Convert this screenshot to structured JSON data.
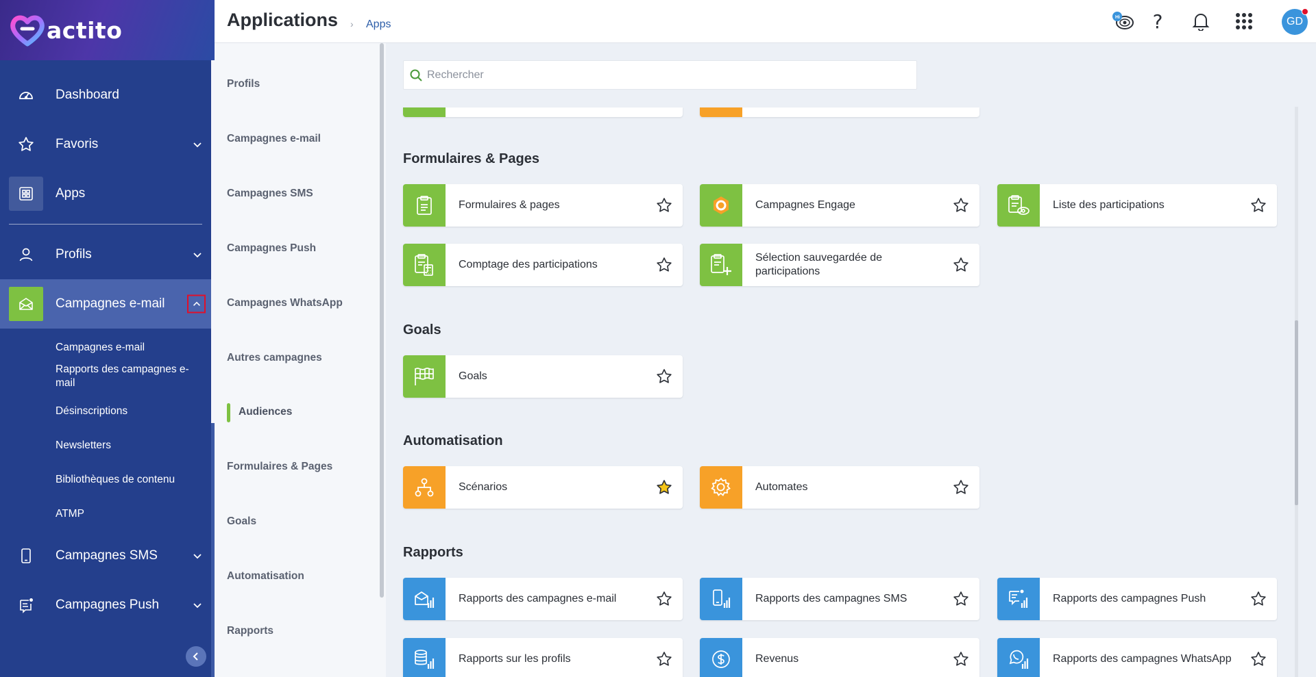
{
  "logo": {
    "text": "actito"
  },
  "sidebar": {
    "items": [
      {
        "id": "dashboard",
        "label": "Dashboard",
        "icon": "gauge-icon"
      },
      {
        "id": "favoris",
        "label": "Favoris",
        "icon": "star-icon"
      },
      {
        "id": "apps",
        "label": "Apps",
        "icon": "apps-grid-icon"
      },
      {
        "id": "profils",
        "label": "Profils",
        "icon": "user-icon"
      },
      {
        "id": "campagnes-email",
        "label": "Campagnes e-mail",
        "icon": "envelope-open-icon"
      },
      {
        "id": "campagnes-sms",
        "label": "Campagnes SMS",
        "icon": "phone-icon"
      },
      {
        "id": "campagnes-push",
        "label": "Campagnes Push",
        "icon": "push-message-icon"
      }
    ],
    "subitems": [
      "Campagnes e-mail",
      "Rapports des campagnes e-mail",
      "Désinscriptions",
      "Newsletters",
      "Bibliothèques de contenu",
      "ATMP"
    ]
  },
  "header": {
    "title": "Applications",
    "breadcrumb_sep": "›",
    "breadcrumb": "Apps",
    "help": "?",
    "avatar": "GD",
    "hi_badge": "Hi"
  },
  "categories": [
    "Profils",
    "Campagnes e-mail",
    "Campagnes SMS",
    "Campagnes Push",
    "Campagnes WhatsApp",
    "Autres campagnes",
    "Audiences",
    "Formulaires & Pages",
    "Goals",
    "Automatisation",
    "Rapports"
  ],
  "active_category": "Audiences",
  "search": {
    "placeholder": "Rechercher",
    "value": ""
  },
  "sections": {
    "formulaires": {
      "title": "Formulaires & Pages",
      "cards": [
        {
          "label": "Formulaires & pages",
          "color": "green",
          "icon": "clipboard-icon",
          "favorite": false
        },
        {
          "label": "Campagnes Engage",
          "color": "green",
          "icon": "engage-hexagon-icon",
          "favorite": false
        },
        {
          "label": "Liste des participations",
          "color": "green",
          "icon": "clipboard-eye-icon",
          "favorite": false
        },
        {
          "label": "Comptage des participations",
          "color": "green",
          "icon": "clipboard-calculator-icon",
          "favorite": false
        },
        {
          "label": "Sélection sauvegardée de participations",
          "color": "green",
          "icon": "clipboard-plus-icon",
          "favorite": false
        }
      ]
    },
    "goals": {
      "title": "Goals",
      "cards": [
        {
          "label": "Goals",
          "color": "green",
          "icon": "flag-icon",
          "favorite": false
        }
      ]
    },
    "automatisation": {
      "title": "Automatisation",
      "cards": [
        {
          "label": "Scénarios",
          "color": "orange",
          "icon": "scenario-tree-icon",
          "favorite": true
        },
        {
          "label": "Automates",
          "color": "orange",
          "icon": "gear-icon",
          "favorite": false
        }
      ]
    },
    "rapports": {
      "title": "Rapports",
      "cards": [
        {
          "label": "Rapports des campagnes e-mail",
          "color": "blue",
          "icon": "email-report-icon",
          "favorite": false
        },
        {
          "label": "Rapports des campagnes SMS",
          "color": "blue",
          "icon": "sms-report-icon",
          "favorite": false
        },
        {
          "label": "Rapports des campagnes Push",
          "color": "blue",
          "icon": "push-report-icon",
          "favorite": false
        },
        {
          "label": "Rapports sur les profils",
          "color": "blue",
          "icon": "database-report-icon",
          "favorite": false
        },
        {
          "label": "Revenus",
          "color": "blue",
          "icon": "dollar-coin-icon",
          "favorite": false
        },
        {
          "label": "Rapports des campagnes WhatsApp",
          "color": "blue",
          "icon": "whatsapp-report-icon",
          "favorite": false
        }
      ]
    }
  },
  "colors": {
    "sidebar": "#243f8c",
    "sidebar_active": "#4a64ad",
    "green": "#7ec142",
    "orange": "#f7a128",
    "blue": "#3a94dc",
    "star_favorite": "#f5c518",
    "highlight_box": "#e0102a"
  }
}
